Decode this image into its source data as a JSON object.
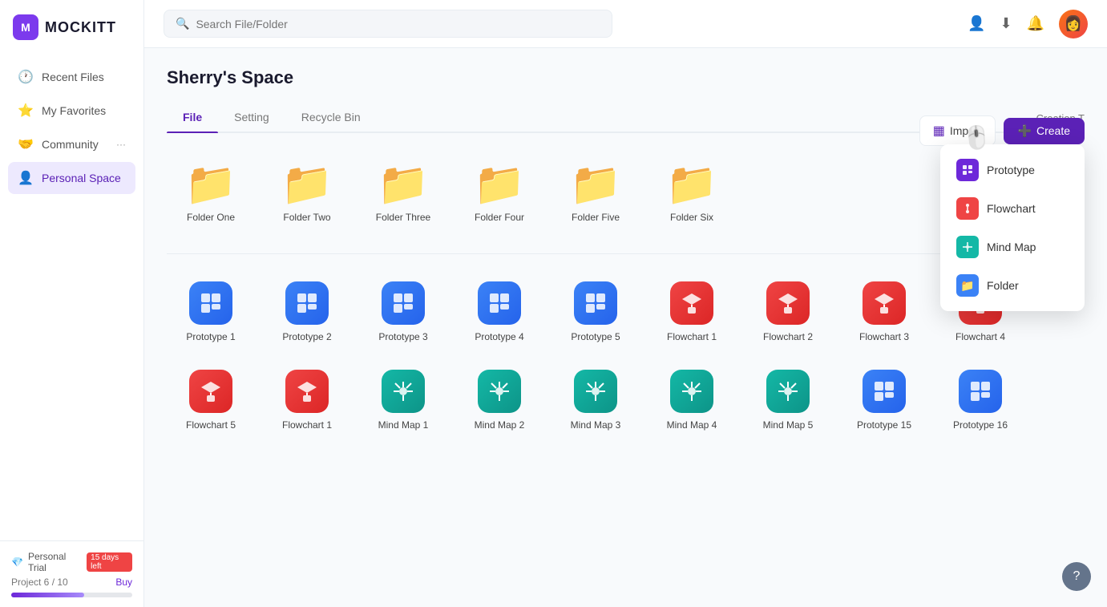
{
  "app": {
    "logo_letter": "M",
    "logo_name": "MOCKITT"
  },
  "sidebar": {
    "items": [
      {
        "id": "recent-files",
        "label": "Recent Files",
        "icon": "🕐",
        "active": false
      },
      {
        "id": "my-favorites",
        "label": "My Favorites",
        "icon": "⭐",
        "active": false
      },
      {
        "id": "community",
        "label": "Community",
        "icon": "🤝",
        "active": false,
        "arrow": "···"
      },
      {
        "id": "personal-space",
        "label": "Personal Space",
        "icon": "👤",
        "active": true
      }
    ],
    "trial": {
      "label": "Personal Trial",
      "badge": "15 days left",
      "project_label": "Project  6 / 10",
      "buy": "Buy"
    }
  },
  "header": {
    "search_placeholder": "Search File/Folder"
  },
  "page": {
    "title": "Sherry's Space",
    "tabs": [
      {
        "id": "file",
        "label": "File",
        "active": true
      },
      {
        "id": "setting",
        "label": "Setting",
        "active": false
      },
      {
        "id": "recycle-bin",
        "label": "Recycle Bin",
        "active": false
      }
    ],
    "creation_label": "Creation T"
  },
  "action_buttons": {
    "import": "Import",
    "create": "Create"
  },
  "folders": [
    {
      "id": "folder-one",
      "name": "Folder One"
    },
    {
      "id": "folder-two",
      "name": "Folder Two"
    },
    {
      "id": "folder-three",
      "name": "Folder Three"
    },
    {
      "id": "folder-four",
      "name": "Folder Four"
    },
    {
      "id": "folder-five",
      "name": "Folder Five"
    },
    {
      "id": "folder-six",
      "name": "Folder Six"
    }
  ],
  "files": [
    {
      "id": "prototype-1",
      "name": "Prototype 1",
      "type": "prototype",
      "icon_type": "blue"
    },
    {
      "id": "prototype-2",
      "name": "Prototype 2",
      "type": "prototype",
      "icon_type": "blue"
    },
    {
      "id": "prototype-3",
      "name": "Prototype 3",
      "type": "prototype",
      "icon_type": "blue"
    },
    {
      "id": "prototype-4",
      "name": "Prototype 4",
      "type": "prototype",
      "icon_type": "blue"
    },
    {
      "id": "prototype-5",
      "name": "Prototype 5",
      "type": "prototype",
      "icon_type": "blue"
    },
    {
      "id": "flowchart-1",
      "name": "Flowchart 1",
      "type": "flowchart",
      "icon_type": "red"
    },
    {
      "id": "flowchart-2",
      "name": "Flowchart 2",
      "type": "flowchart",
      "icon_type": "red"
    },
    {
      "id": "flowchart-3",
      "name": "Flowchart 3",
      "type": "flowchart",
      "icon_type": "red"
    },
    {
      "id": "flowchart-4",
      "name": "Flowchart 4",
      "type": "flowchart",
      "icon_type": "red"
    },
    {
      "id": "flowchart-5",
      "name": "Flowchart 5",
      "type": "flowchart",
      "icon_type": "red"
    },
    {
      "id": "flowchart-1b",
      "name": "Flowchart 1",
      "type": "flowchart",
      "icon_type": "red"
    },
    {
      "id": "mindmap-1",
      "name": "Mind Map 1",
      "type": "mindmap",
      "icon_type": "teal"
    },
    {
      "id": "mindmap-2",
      "name": "Mind Map 2",
      "type": "mindmap",
      "icon_type": "teal"
    },
    {
      "id": "mindmap-3",
      "name": "Mind Map 3",
      "type": "mindmap",
      "icon_type": "teal"
    },
    {
      "id": "mindmap-4",
      "name": "Mind Map 4",
      "type": "mindmap",
      "icon_type": "teal"
    },
    {
      "id": "mindmap-5",
      "name": "Mind Map 5",
      "type": "mindmap",
      "icon_type": "teal"
    },
    {
      "id": "prototype-15",
      "name": "Prototype 15",
      "type": "prototype",
      "icon_type": "blue"
    },
    {
      "id": "prototype-16",
      "name": "Prototype 16",
      "type": "prototype",
      "icon_type": "blue"
    }
  ],
  "dropdown": {
    "items": [
      {
        "id": "prototype",
        "label": "Prototype",
        "icon_type": "purple",
        "icon": "▣"
      },
      {
        "id": "flowchart",
        "label": "Flowchart",
        "icon_type": "red",
        "icon": "∿"
      },
      {
        "id": "mindmap",
        "label": "Mind Map",
        "icon_type": "teal",
        "icon": "✦"
      },
      {
        "id": "folder",
        "label": "Folder",
        "icon_type": "blue",
        "icon": "📁"
      }
    ]
  },
  "help": {
    "label": "?"
  }
}
